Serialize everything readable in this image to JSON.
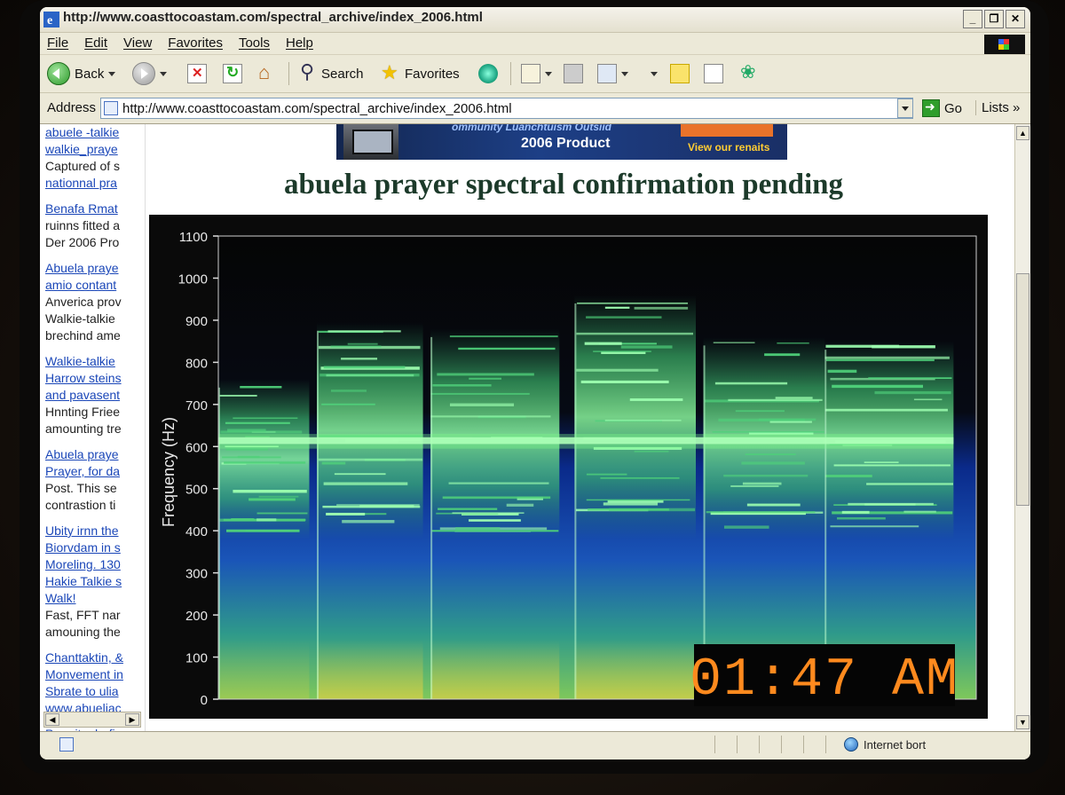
{
  "window": {
    "title": "http://www.coasttocoastam.com/spectral_archive/index_2006.html",
    "buttons": [
      "_",
      "❐",
      "✕"
    ]
  },
  "menu": [
    "File",
    "Edit",
    "View",
    "Favorites",
    "Tools",
    "Help"
  ],
  "toolbar": {
    "back_label": "Back",
    "search_label": "Search",
    "favorites_label": "Favorites"
  },
  "address": {
    "label": "Address",
    "url": "http://www.coasttocoastam.com/spectral_archive/index_2006.html",
    "go_label": "Go",
    "links_label": "Lists »"
  },
  "banner": {
    "tagline": "ommunity Luanchtuism Outsiid",
    "product": "2006 Product",
    "rebates": "View our renaits"
  },
  "sidebar": [
    {
      "links": [
        "abuele -talkie",
        "walkie_praye"
      ],
      "texts": [
        "Captured of s"
      ],
      "links2": [
        "nationnal pra"
      ]
    },
    {
      "links": [
        "Benafa Rmat"
      ],
      "texts": [
        "ruinns fitted a",
        "Der 2006 Pro"
      ],
      "links2": []
    },
    {
      "links": [
        "Abuela praye",
        "amio contant"
      ],
      "texts": [
        "Anverica prov",
        "Walkie-talkie",
        "brechind ame"
      ],
      "links2": []
    },
    {
      "links": [
        "Walkie-talkie",
        "Harrow steins",
        "and pavasent"
      ],
      "texts": [
        "Hnnting Friee",
        "amounting tre"
      ],
      "links2": []
    },
    {
      "links": [
        "Abuela praye",
        "Prayer, for da"
      ],
      "texts": [
        "Post. This se",
        "contrastion ti"
      ],
      "links2": []
    },
    {
      "links": [
        "Ubity irnn the",
        "Biorvdam in s",
        "Moreling. 130",
        "Hakie Talkie s",
        "Walk!"
      ],
      "texts": [
        "Fast, FFT nar",
        "amouning the"
      ],
      "links2": []
    },
    {
      "links": [
        "Chanttaktin, &",
        "Monvement in",
        "Sbrate to ulia",
        "www.abueliac"
      ],
      "texts": [],
      "links2": []
    },
    {
      "links": [
        "Pramits darfi"
      ],
      "texts": [],
      "links2": []
    }
  ],
  "page": {
    "title": "abuela prayer spectral confirmation pending"
  },
  "chart_data": {
    "type": "heatmap",
    "title": "",
    "xlabel": "",
    "ylabel": "Frequency (Hz)",
    "ylim": [
      0,
      1100
    ],
    "yticks": [
      0,
      100,
      200,
      300,
      400,
      500,
      600,
      700,
      800,
      900,
      1000,
      1100
    ],
    "grid": false,
    "colormap": "dark-blue-green-yellow",
    "colors": {
      "background": "#000000",
      "low": "#0a2a8a",
      "mid": "#2aaa55",
      "high": "#7dff8a",
      "warm": "#f0d040"
    },
    "segments": [
      {
        "x_start": 0,
        "x_end": 0.12,
        "top_hz": 760,
        "peak_hz": 615
      },
      {
        "x_start": 0.13,
        "x_end": 0.27,
        "top_hz": 895,
        "peak_hz": 620
      },
      {
        "x_start": 0.28,
        "x_end": 0.45,
        "top_hz": 880,
        "peak_hz": 620
      },
      {
        "x_start": 0.47,
        "x_end": 0.63,
        "top_hz": 960,
        "peak_hz": 620
      },
      {
        "x_start": 0.64,
        "x_end": 0.8,
        "top_hz": 860,
        "peak_hz": 615
      },
      {
        "x_start": 0.8,
        "x_end": 0.97,
        "top_hz": 850,
        "peak_hz": 610
      }
    ],
    "timestamp": "01:47 AM"
  },
  "status": {
    "zone_label": "Internet bort"
  }
}
